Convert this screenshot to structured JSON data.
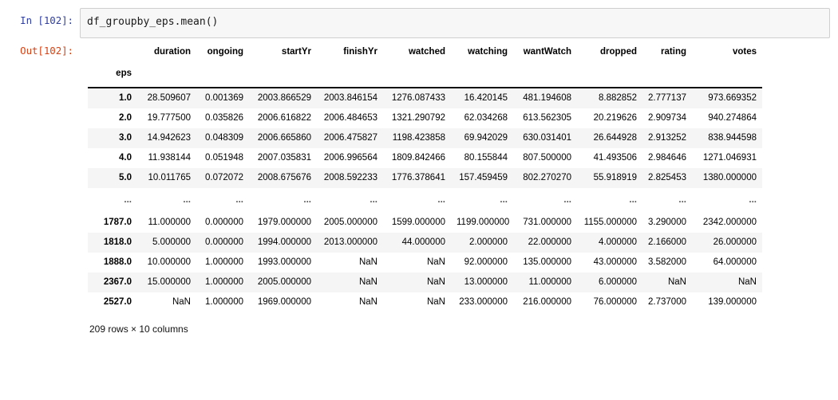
{
  "notebook": {
    "input_prompt": "In [102]:",
    "output_prompt": "Out[102]:",
    "code": "df_groupby_eps.mean()",
    "prompt_in_color": "#303F9F",
    "prompt_out_color": "#D84315",
    "code_bg": "#f7f7f7",
    "code_border": "#cfcfcf"
  },
  "table": {
    "index_name": "eps",
    "columns": [
      "duration",
      "ongoing",
      "startYr",
      "finishYr",
      "watched",
      "watching",
      "wantWatch",
      "dropped",
      "rating",
      "votes"
    ],
    "rows": [
      {
        "index": "1.0",
        "cells": [
          "28.509607",
          "0.001369",
          "2003.866529",
          "2003.846154",
          "1276.087433",
          "16.420145",
          "481.194608",
          "8.882852",
          "2.777137",
          "973.669352"
        ]
      },
      {
        "index": "2.0",
        "cells": [
          "19.777500",
          "0.035826",
          "2006.616822",
          "2006.484653",
          "1321.290792",
          "62.034268",
          "613.562305",
          "20.219626",
          "2.909734",
          "940.274864"
        ]
      },
      {
        "index": "3.0",
        "cells": [
          "14.942623",
          "0.048309",
          "2006.665860",
          "2006.475827",
          "1198.423858",
          "69.942029",
          "630.031401",
          "26.644928",
          "2.913252",
          "838.944598"
        ]
      },
      {
        "index": "4.0",
        "cells": [
          "11.938144",
          "0.051948",
          "2007.035831",
          "2006.996564",
          "1809.842466",
          "80.155844",
          "807.500000",
          "41.493506",
          "2.984646",
          "1271.046931"
        ]
      },
      {
        "index": "5.0",
        "cells": [
          "10.011765",
          "0.072072",
          "2008.675676",
          "2008.592233",
          "1776.378641",
          "157.459459",
          "802.270270",
          "55.918919",
          "2.825453",
          "1380.000000"
        ]
      },
      {
        "index": "...",
        "cells": [
          "...",
          "...",
          "...",
          "...",
          "...",
          "...",
          "...",
          "...",
          "...",
          "..."
        ],
        "ellipsis": true
      },
      {
        "index": "1787.0",
        "cells": [
          "11.000000",
          "0.000000",
          "1979.000000",
          "2005.000000",
          "1599.000000",
          "1199.000000",
          "731.000000",
          "1155.000000",
          "3.290000",
          "2342.000000"
        ]
      },
      {
        "index": "1818.0",
        "cells": [
          "5.000000",
          "0.000000",
          "1994.000000",
          "2013.000000",
          "44.000000",
          "2.000000",
          "22.000000",
          "4.000000",
          "2.166000",
          "26.000000"
        ]
      },
      {
        "index": "1888.0",
        "cells": [
          "10.000000",
          "1.000000",
          "1993.000000",
          "NaN",
          "NaN",
          "92.000000",
          "135.000000",
          "43.000000",
          "3.582000",
          "64.000000"
        ]
      },
      {
        "index": "2367.0",
        "cells": [
          "15.000000",
          "1.000000",
          "2005.000000",
          "NaN",
          "NaN",
          "13.000000",
          "11.000000",
          "6.000000",
          "NaN",
          "NaN"
        ]
      },
      {
        "index": "2527.0",
        "cells": [
          "NaN",
          "1.000000",
          "1969.000000",
          "NaN",
          "NaN",
          "233.000000",
          "216.000000",
          "76.000000",
          "2.737000",
          "139.000000"
        ]
      }
    ],
    "shape_note": "209 rows × 10 columns"
  }
}
